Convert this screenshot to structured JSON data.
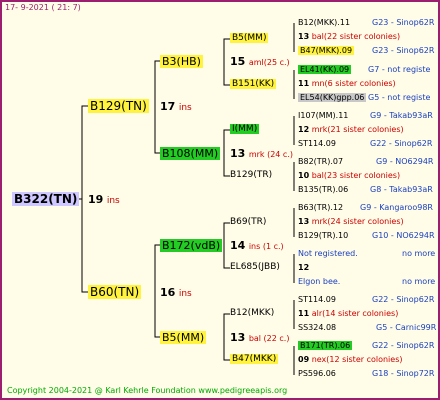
{
  "header": {
    "date": "17-   9-2021  (  21:   7)"
  },
  "footer": {
    "text": "Copyright 2004-2021 @ Karl Kehrle Foundation      www.pedigreeapis.org"
  },
  "root": {
    "name": "B322(TN)",
    "ins": "19",
    "ins_label": "ins"
  },
  "gen1": [
    {
      "name": "B129(TN)",
      "num": "17",
      "label": "ins"
    },
    {
      "name": "B60(TN)",
      "num": "16",
      "label": "ins"
    }
  ],
  "gen2": [
    {
      "name": "B3(HB)",
      "num": "15",
      "label": "aml(25 c.)"
    },
    {
      "name": "B108(MM)",
      "num": "13",
      "label": "mrk (24 c.)"
    },
    {
      "name": "B172(vdB)",
      "num": "14",
      "label": "ins  (1 c.)"
    },
    {
      "name": "B5(MM)",
      "num": "13",
      "label": "bal (22 c.)"
    }
  ],
  "gen3": [
    {
      "name": "B5(MM)"
    },
    {
      "name": "B151(KK)"
    },
    {
      "name": "I(MM)"
    },
    {
      "name": "B129(TR)"
    },
    {
      "name": "B69(TR)"
    },
    {
      "name": "EL685(JBB)"
    },
    {
      "name": "B12(MKK)"
    },
    {
      "name": "B47(MKK)"
    }
  ],
  "gen4": [
    {
      "parent": "B12(MKK).11",
      "num": "13",
      "note": "bal(22 sister colonies)",
      "mother": "B47(MKK).09",
      "code1": "G23 - Sinop62R",
      "code2": "G23 - Sinop62R"
    },
    {
      "parent": "EL41(KK).09",
      "num": "11",
      "note": "mn(6 sister colonies)",
      "mother": "EL54(KK)gpp.06",
      "code1": "G7 - not registe",
      "code2": "G5 - not registe"
    },
    {
      "parent": "I107(MM).11",
      "num": "12",
      "note": "mrk(21 sister colonies)",
      "mother": "ST114.09",
      "code1": "G9 - Takab93aR",
      "code2": "G22 - Sinop62R"
    },
    {
      "parent": "B82(TR).07",
      "num": "10",
      "note": "bal(23 sister colonies)",
      "mother": "B135(TR).06",
      "code1": "G9 - NO6294R",
      "code2": "G8 - Takab93aR"
    },
    {
      "parent": "B63(TR).12",
      "num": "13",
      "note": "mrk(24 sister colonies)",
      "mother": "B129(TR).10",
      "code1": "G9 - Kangaroo98R",
      "code2": "G10 - NO6294R"
    },
    {
      "parent": "Not registered.",
      "num": "12",
      "note": "",
      "mother": "Elgon bee.",
      "code1": "no more",
      "code2": "no more"
    },
    {
      "parent": "ST114.09",
      "num": "11",
      "note": "alr(14 sister colonies)",
      "mother": "SS324.08",
      "code1": "G22 - Sinop62R",
      "code2": "G5 - Carnic99R"
    },
    {
      "parent": "B171(TR).06",
      "num": "09",
      "note": "nex(12 sister colonies)",
      "mother": "PS596.06",
      "code1": "G22 - Sinop62R",
      "code2": "G18 - Sinop72R"
    }
  ]
}
